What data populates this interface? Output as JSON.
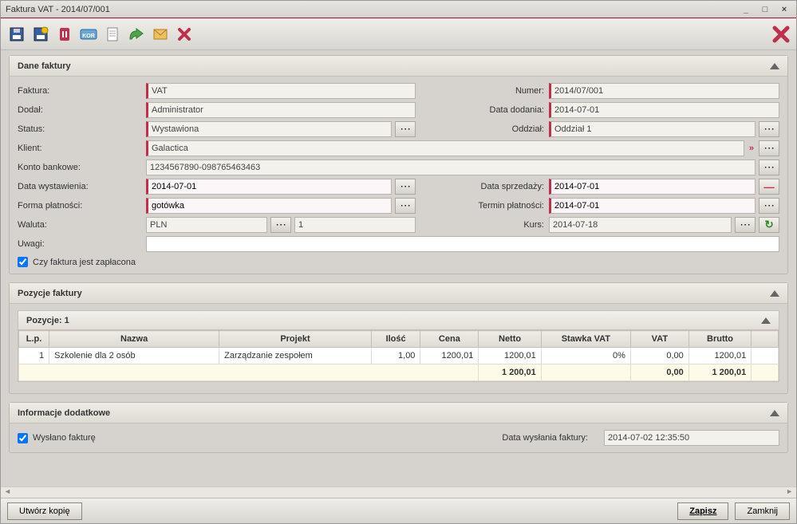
{
  "window": {
    "title": "Faktura VAT - 2014/07/001"
  },
  "titlebar_controls": {
    "min": "_",
    "max": "□",
    "close": "×"
  },
  "sections": {
    "dane_faktury": "Dane faktury",
    "pozycje_faktury": "Pozycje faktury",
    "informacje_dodatkowe": "Informacje dodatkowe"
  },
  "labels": {
    "faktura": "Faktura:",
    "numer": "Numer:",
    "dodal": "Dodał:",
    "data_dodania": "Data dodania:",
    "status": "Status:",
    "oddzial": "Oddział:",
    "klient": "Klient:",
    "konto": "Konto bankowe:",
    "data_wyst": "Data wystawienia:",
    "data_sprz": "Data sprzedaży:",
    "forma_plat": "Forma płatności:",
    "termin_plat": "Termin płatności:",
    "waluta": "Waluta:",
    "kurs": "Kurs:",
    "uwagi": "Uwagi:",
    "czy_zaplacona": "Czy faktura jest zapłacona",
    "wyslano": "Wysłano fakturę",
    "data_wyslania": "Data wysłania faktury:"
  },
  "values": {
    "faktura": "VAT",
    "numer": "2014/07/001",
    "dodal": "Administrator",
    "data_dodania": "2014-07-01",
    "status": "Wystawiona",
    "oddzial": "Oddział 1",
    "klient": "Galactica",
    "konto": "1234567890-098765463463",
    "data_wyst": "2014-07-01",
    "data_sprz": "2014-07-01",
    "forma_plat": "gotówka",
    "termin_plat": "2014-07-01",
    "waluta": "PLN",
    "waluta_num": "1",
    "kurs": "2014-07-18",
    "uwagi": "",
    "data_wyslania": "2014-07-02 12:35:50"
  },
  "positions": {
    "header": "Pozycje: 1",
    "columns": {
      "lp": "L.p.",
      "nazwa": "Nazwa",
      "projekt": "Projekt",
      "ilosc": "Ilość",
      "cena": "Cena",
      "netto": "Netto",
      "stawka": "Stawka VAT",
      "vat": "VAT",
      "brutto": "Brutto"
    },
    "rows": [
      {
        "lp": "1",
        "nazwa": "Szkolenie dla 2 osób",
        "projekt": "Zarządzanie zespołem",
        "ilosc": "1,00",
        "cena": "1200,01",
        "netto": "1200,01",
        "stawka": "0%",
        "vat": "0,00",
        "brutto": "1200,01"
      }
    ],
    "totals": {
      "netto": "1 200,01",
      "vat": "0,00",
      "brutto": "1 200,01"
    }
  },
  "footer": {
    "kopia": "Utwórz kopię",
    "zapisz": "Zapisz",
    "zamknij": "Zamknij"
  }
}
